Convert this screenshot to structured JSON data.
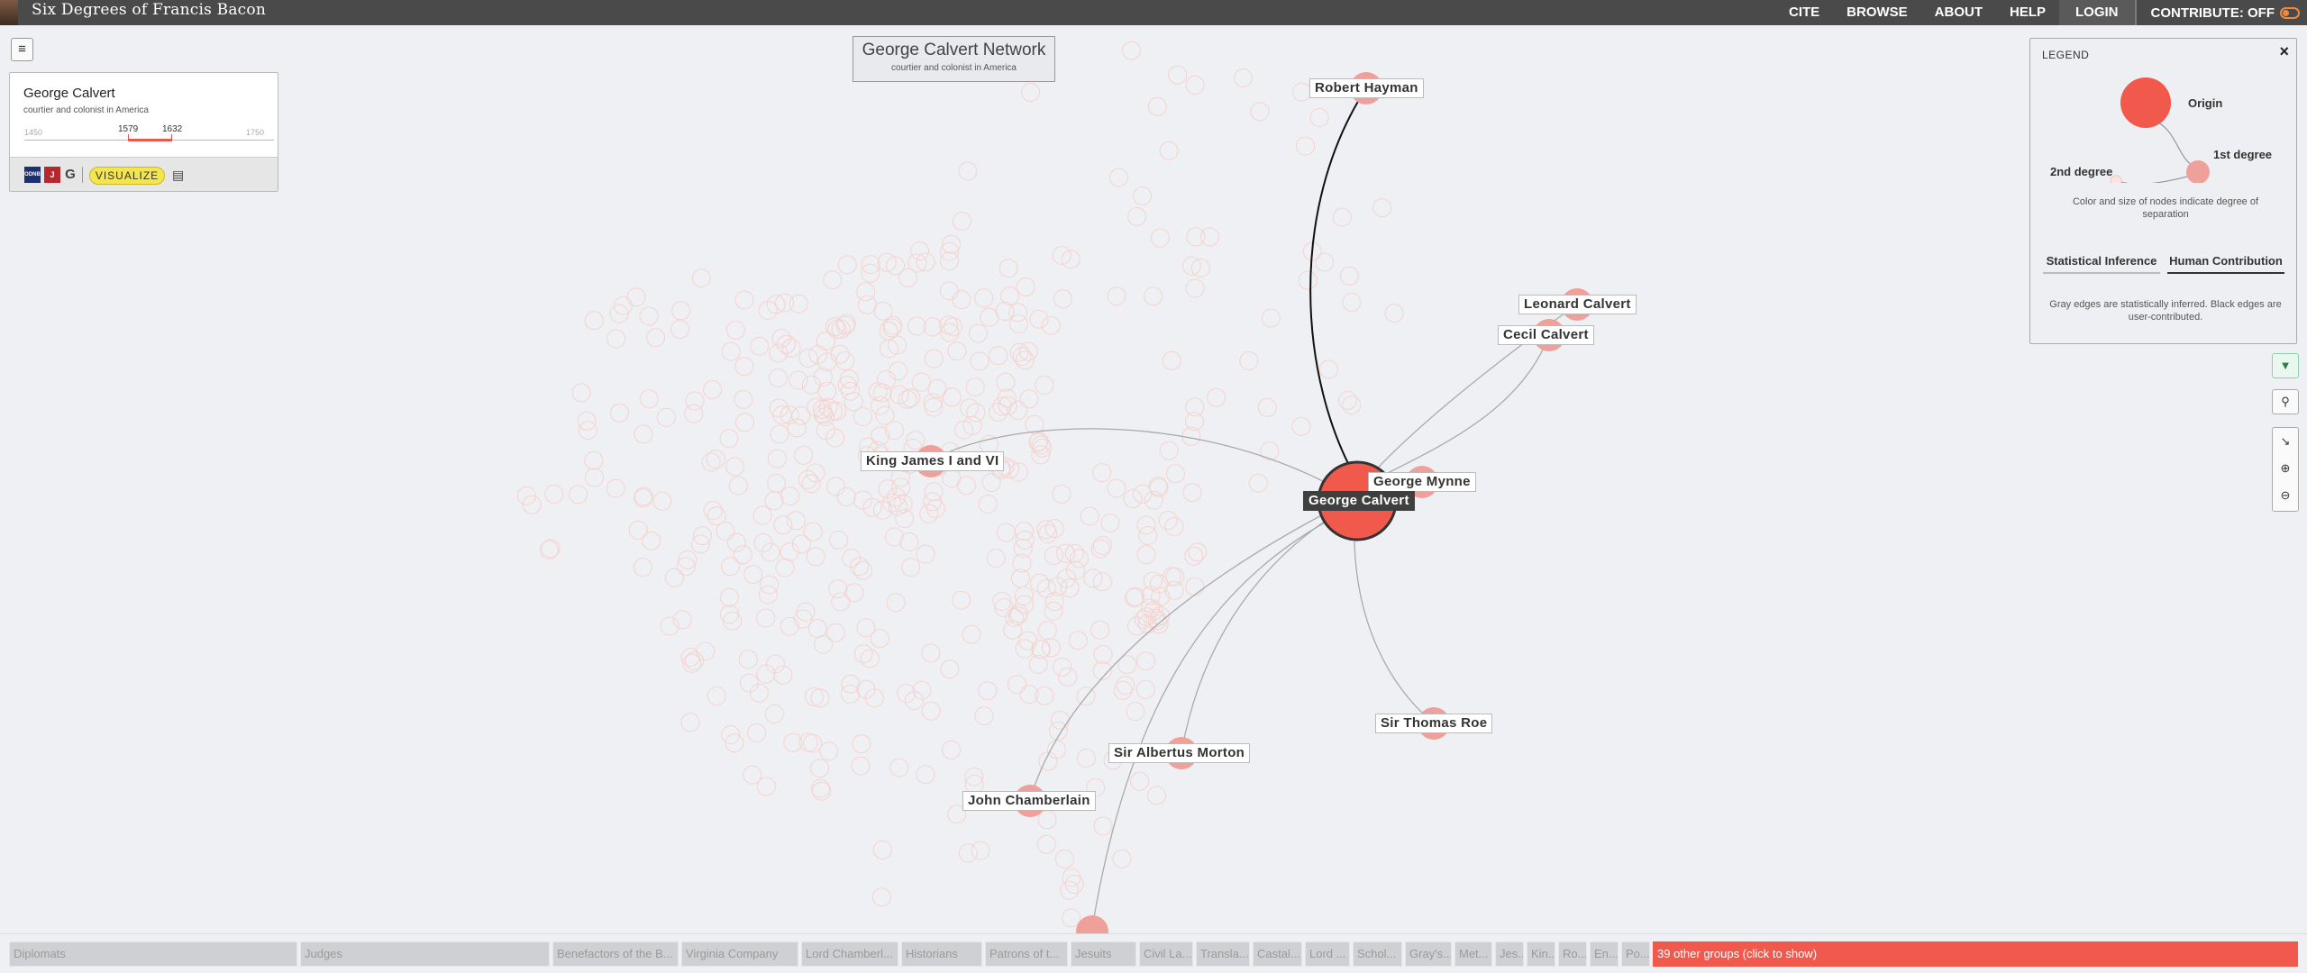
{
  "app": {
    "title": "Six Degrees of Francis Bacon",
    "nav": [
      "CITE",
      "BROWSE",
      "ABOUT",
      "HELP",
      "LOGIN"
    ],
    "contribute_label": "CONTRIBUTE: OFF"
  },
  "menu_button": "≡",
  "person": {
    "name": "George Calvert",
    "description": "courtier and colonist in America",
    "timeline_min": "1450",
    "timeline_max": "1750",
    "birth": "1579",
    "death": "1632",
    "visualize_label": "VISUALIZE",
    "source_icons": [
      "ODNB",
      "J",
      "G"
    ]
  },
  "network": {
    "title": "George Calvert Network",
    "subtitle": "courtier and colonist in America"
  },
  "nodes": [
    {
      "name": "George Calvert",
      "degree": "origin"
    },
    {
      "name": "Robert Hayman",
      "degree": "1st"
    },
    {
      "name": "Leonard Calvert",
      "degree": "1st"
    },
    {
      "name": "Cecil Calvert",
      "degree": "1st"
    },
    {
      "name": "George Mynne",
      "degree": "1st"
    },
    {
      "name": "King James I and VI",
      "degree": "1st"
    },
    {
      "name": "Sir Thomas Roe",
      "degree": "1st"
    },
    {
      "name": "Sir Albertus Morton",
      "degree": "1st"
    },
    {
      "name": "John Chamberlain",
      "degree": "1st"
    }
  ],
  "legend": {
    "title": "LEGEND",
    "close": "×",
    "origin_label": "Origin",
    "first_label": "1st degree",
    "second_label": "2nd degree",
    "note": "Color and size of nodes indicate degree of separation",
    "tab_statistical": "Statistical Inference",
    "tab_human": "Human Contribution",
    "edge_note": "Gray edges are statistically inferred. Black edges are user-contributed."
  },
  "colors": {
    "origin": "#f1594d",
    "first_degree": "#f0a09a",
    "second_degree": "#f3d3cf",
    "topbar": "#4a4a4a",
    "visualize": "#f4e64a",
    "other_groups": "#f1594d"
  },
  "icons": {
    "filter": "filter-icon",
    "search": "search-icon",
    "collapse": "collapse-icon",
    "zoom_in": "zoom-in-icon",
    "zoom_out": "zoom-out-icon"
  },
  "groups": [
    "Diplomats",
    "Judges",
    "Benefactors of the B...",
    "Virginia Company",
    "Lord Chamberl...",
    "Historians",
    "Patrons of t...",
    "Jesuits",
    "Civil La...",
    "Transla...",
    "Castal...",
    "Lord ...",
    "Schol...",
    "Gray's...",
    "Met...",
    "Jes...",
    "Kin...",
    "Ro...",
    "En...",
    "Po..."
  ],
  "other_groups_label": "39 other groups (click to show)"
}
